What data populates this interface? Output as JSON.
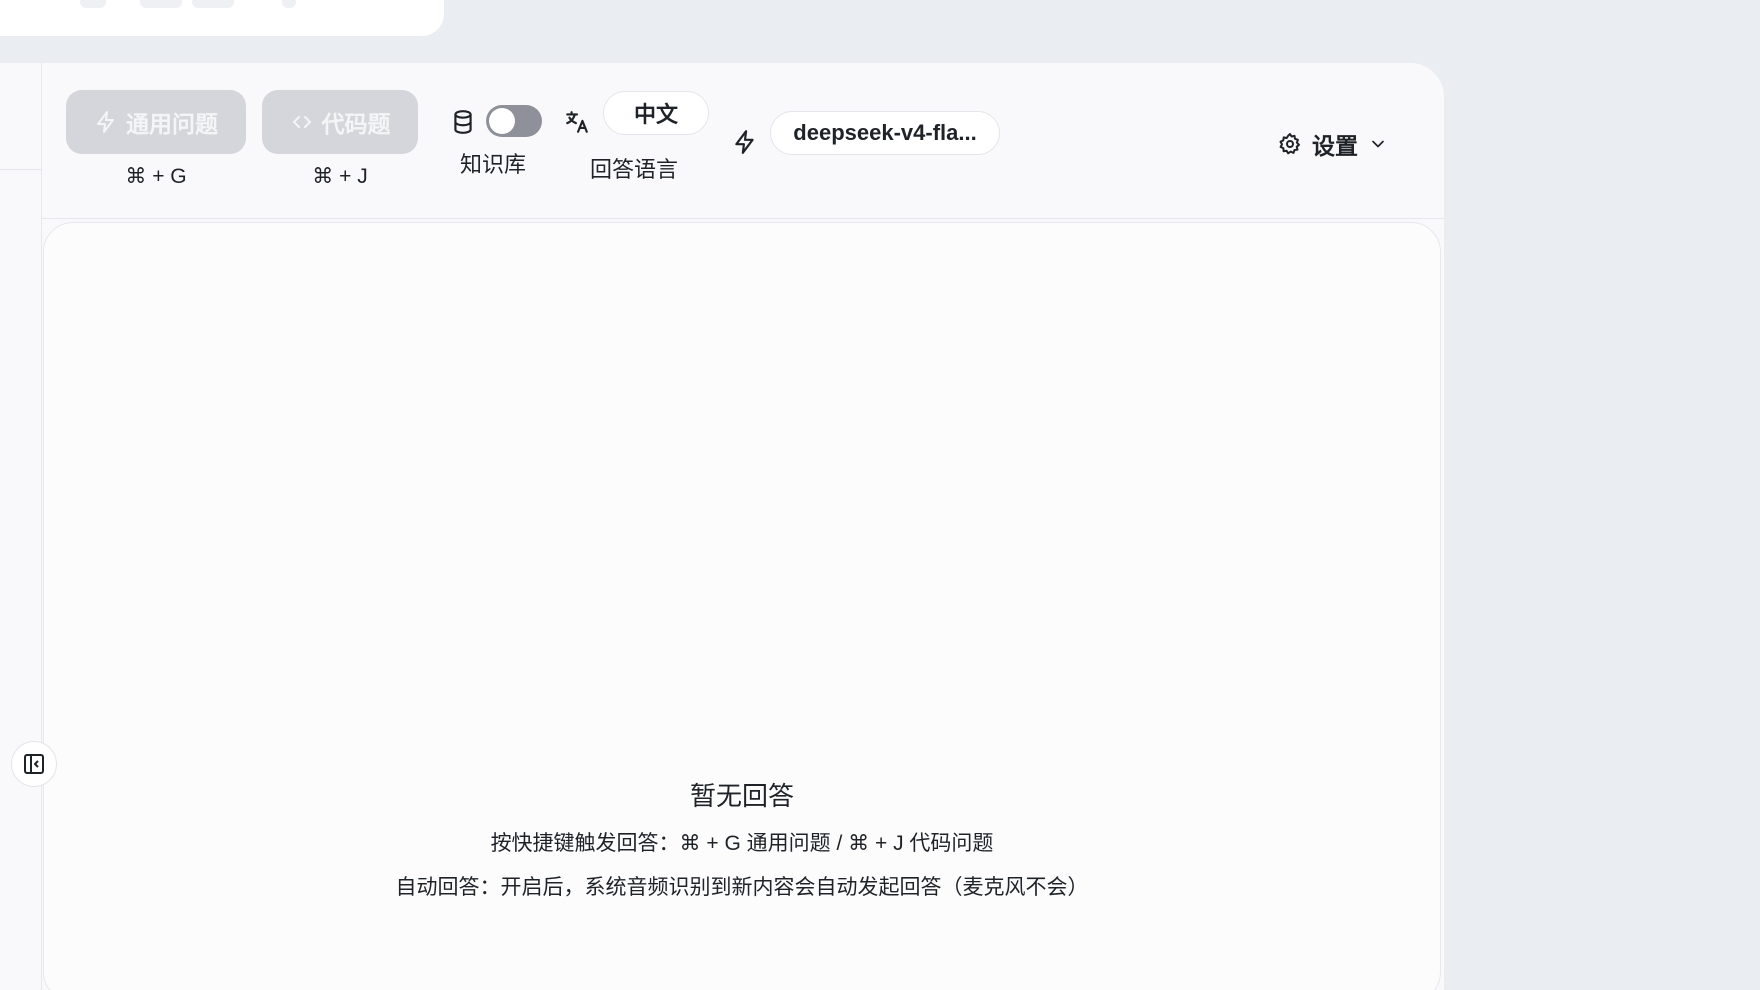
{
  "toolbar": {
    "general_button": {
      "label": "通用问题",
      "shortcut": "⌘ + G"
    },
    "code_button": {
      "label": "代码题",
      "shortcut": "⌘ + J"
    },
    "knowledge_base": {
      "label": "知识库",
      "enabled": false
    },
    "answer_language": {
      "value": "中文",
      "label": "回答语言"
    },
    "model": {
      "value": "deepseek-v4-fla..."
    },
    "settings": {
      "label": "设置"
    }
  },
  "empty_state": {
    "title": "暂无回答",
    "hint": "按快捷键触发回答：⌘ + G 通用问题 / ⌘ + J 代码问题",
    "auto_hint": "自动回答：开启后，系统音频识别到新内容会自动发起回答（麦克风不会）"
  },
  "colors": {
    "disabled_button": "#d4d6db",
    "toggle_off": "#8e9199",
    "panel_bg": "#f9f9fb"
  },
  "icons": [
    "bolt-icon",
    "code-icon",
    "database-icon",
    "translate-icon",
    "gear-icon",
    "chevron-down-icon",
    "sidebar-collapse-icon"
  ]
}
